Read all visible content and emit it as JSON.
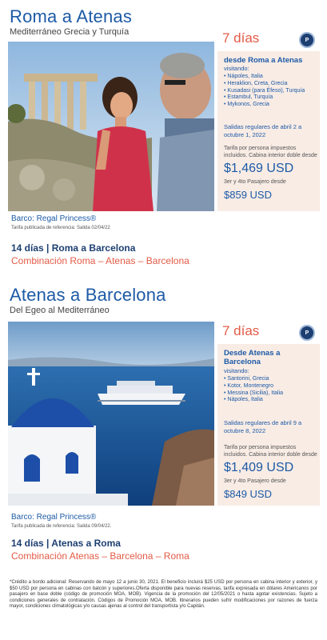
{
  "offers": [
    {
      "title": "Roma a Atenas",
      "subtitle": "Mediterráneo Grecia y Turquía",
      "days": "7 días",
      "logo_text": "P",
      "panel_heading": "desde Roma a Atenas",
      "visiting_label": "visitando:",
      "ports": [
        "Nápoles, Italia",
        "Heraklion, Creta, Grecia",
        "Kusadasi (para Éfeso), Turquía",
        "Estambul, Turquía",
        "Mykonos, Grecia"
      ],
      "dates": "Salidas regulares de abril 2 a octubre 1, 2022",
      "price_note": "Tarifa por persona impuestos incluidos. Cabina interior doble desde",
      "price": "$1,469 USD",
      "extra_note": "3er y 4to Pasajero desde",
      "extra_price": "$859 USD",
      "ship": "Barco: Regal Princess®",
      "reference": "Tarifa publicada de referencia: Salida 02/04/22",
      "route": "14 días | Roma a Barcelona",
      "combination": "Combinación Roma – Atenas – Barcelona"
    },
    {
      "title": "Atenas a Barcelona",
      "subtitle": "Del Egeo al Mediterráneo",
      "days": "7 días",
      "logo_text": "P",
      "panel_heading": "Desde Atenas a Barcelona",
      "visiting_label": "visitando:",
      "ports": [
        "Santorini, Grecia",
        "Kotor, Montenegro",
        "Messina (Sicilia), Italia",
        "Nápoles, Italia"
      ],
      "dates": "Salidas regulares de abril 9 a octubre 8, 2022",
      "price_note": "Tarifa por persona impuestos incluidos. Cabina interior doble desde",
      "price": "$1,409 USD",
      "extra_note": "3er y 4to Pasajero desde",
      "extra_price": "$849 USD",
      "ship": "Barco: Regal Princess®",
      "reference": "Tarifa publicada de referencia: Salida 09/04/22.",
      "route": "14 días | Atenas a Roma",
      "combination": "Combinación Atenas – Barcelona – Roma"
    }
  ],
  "footnote": "*Crédito a bordo adicional: Reservando de mayo 12 a junio 30, 2021. El beneficio incluirá $25 USD por persona en cabina interior y exterior, y $50 USD por persona en cabinas con balcón y superiores.Oferta disponible para nuevas reservas, tarifa expresada en dólares Americanos por pasajero en base doble (código de promoción MOA, MOB). Vigencia de la promoción del 12/05/2021 o hasta agotar existencias. Sujeto a condiciones generales de contratación. Códigos de Promoción MOA, MOB. Itinerarios pueden sufrir modificaciones por razones de fuerza mayor, condiciones climatológicas y/o causas ajenas al control del transportista y/o Capitán.",
  "colors": {
    "title_blue": "#1d5aa6",
    "accent_red": "#e35b47",
    "panel_bg": "#f8ece5",
    "navy": "#1d3f72"
  },
  "icons": {
    "logo": "princess-cruises-logo"
  }
}
